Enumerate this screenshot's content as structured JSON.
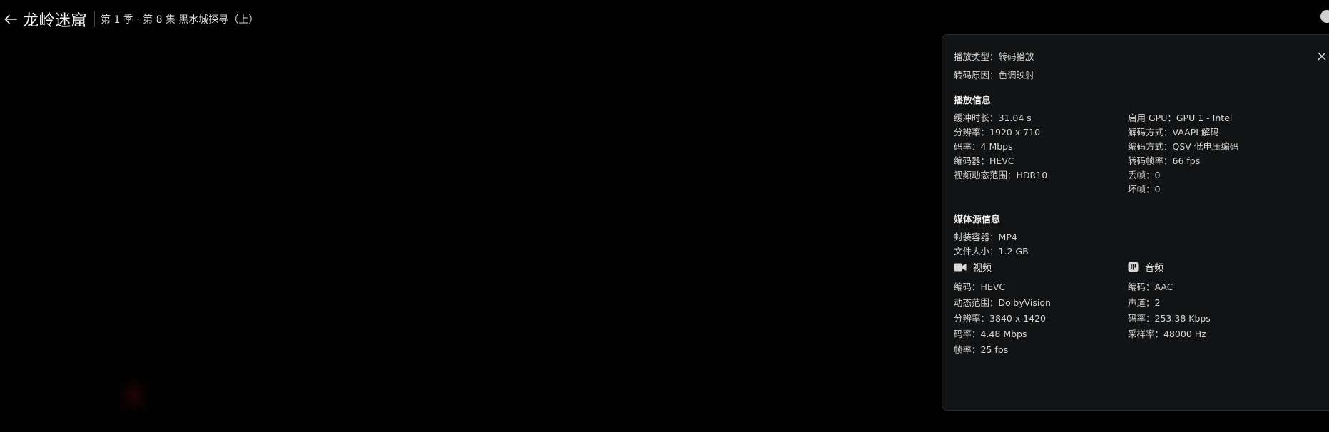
{
  "header": {
    "title": "龙岭迷窟",
    "subtitle": "第 1 季 · 第 8 集 黑水城探寻（上）"
  },
  "panel": {
    "play_type": {
      "key": "播放类型",
      "value": "转码播放"
    },
    "transcode_reason": {
      "key": "转码原因",
      "value": "色调映射"
    },
    "playback": {
      "title": "播放信息",
      "left": [
        {
          "key": "缓冲时长",
          "value": "31.04 s"
        },
        {
          "key": "分辨率",
          "value": "1920 x 710"
        },
        {
          "key": "码率",
          "value": "4 Mbps"
        },
        {
          "key": "编码器",
          "value": "HEVC"
        },
        {
          "key": "视频动态范围",
          "value": "HDR10"
        }
      ],
      "right": [
        {
          "key": "启用 GPU",
          "value": "GPU 1 - Intel"
        },
        {
          "key": "解码方式",
          "value": "VAAPI 解码"
        },
        {
          "key": "编码方式",
          "value": "QSV 低电压编码"
        },
        {
          "key": "转码帧率",
          "value": "66 fps"
        },
        {
          "key": "丢帧",
          "value": "0"
        },
        {
          "key": "坏帧",
          "value": "0"
        }
      ]
    },
    "media": {
      "title": "媒体源信息",
      "container": {
        "key": "封装容器",
        "value": "MP4"
      },
      "size": {
        "key": "文件大小",
        "value": "1.2 GB"
      },
      "video": {
        "label": "视频",
        "icon": "video-camera-icon",
        "items": [
          {
            "key": "编码",
            "value": "HEVC"
          },
          {
            "key": "动态范围",
            "value": "DolbyVision"
          },
          {
            "key": "分辨率",
            "value": "3840 x 1420"
          },
          {
            "key": "码率",
            "value": "4.48 Mbps"
          },
          {
            "key": "帧率",
            "value": "25 fps"
          }
        ]
      },
      "audio": {
        "label": "音频",
        "icon": "audio-icon",
        "items": [
          {
            "key": "编码",
            "value": "AAC"
          },
          {
            "key": "声道",
            "value": "2"
          },
          {
            "key": "码率",
            "value": "253.38 Kbps"
          },
          {
            "key": "采样率",
            "value": "48000 Hz"
          }
        ]
      }
    }
  },
  "colors": {
    "background": "#000000",
    "panel_bg": "#121314",
    "text": "#d6d6d6"
  }
}
